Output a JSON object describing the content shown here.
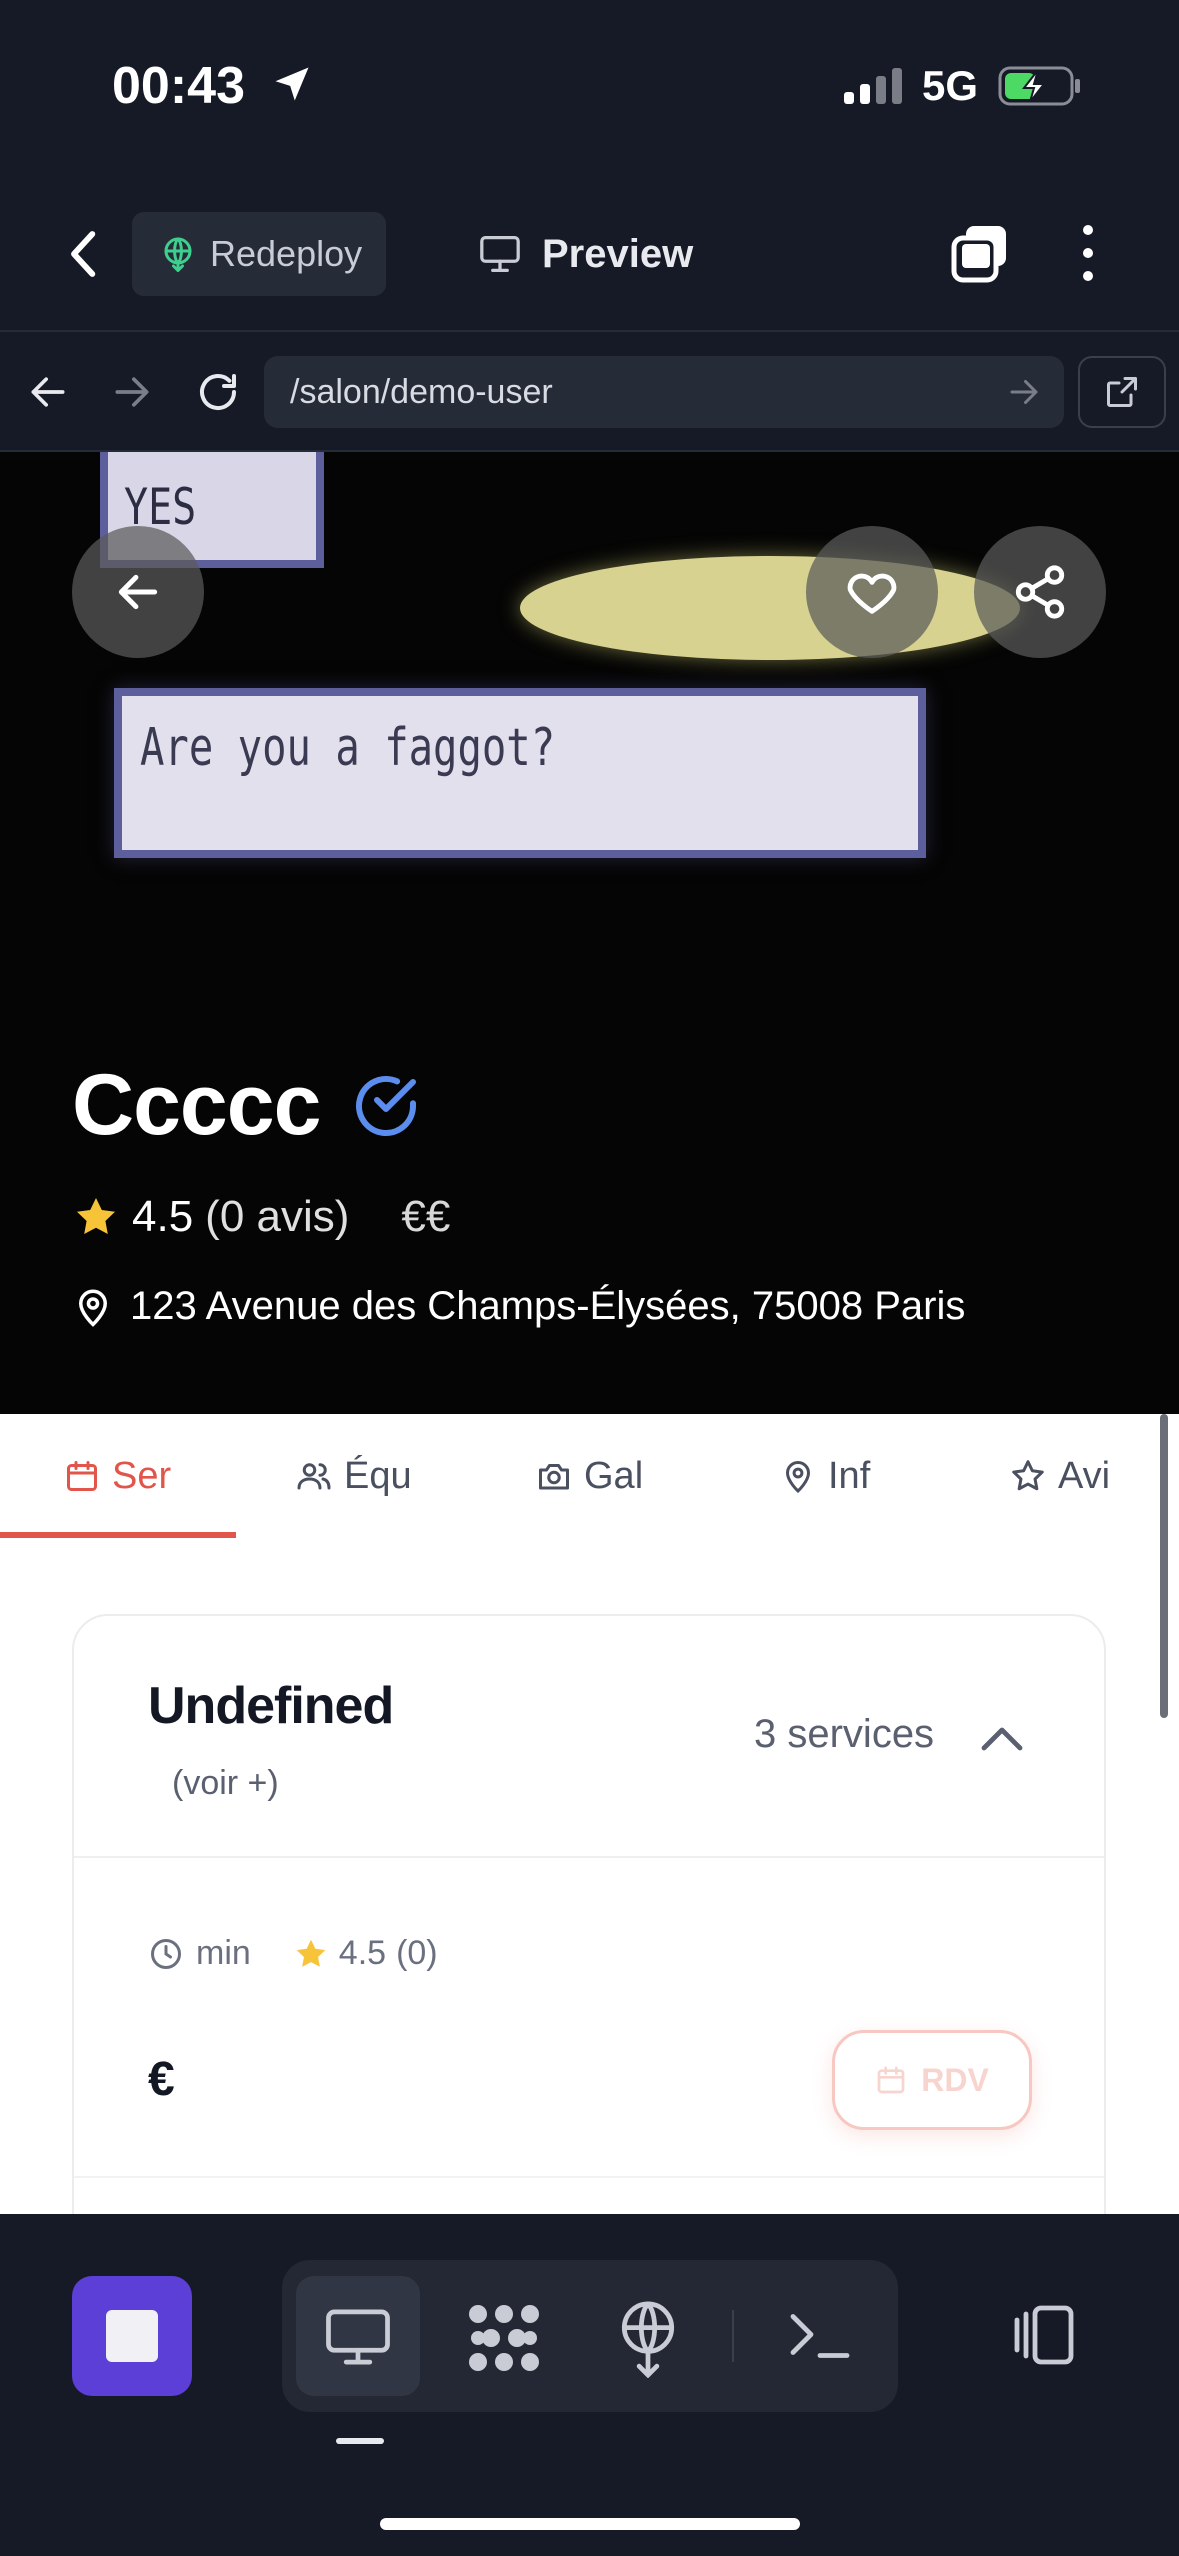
{
  "status_bar": {
    "time": "00:43",
    "network": "5G",
    "battery_state": "charging"
  },
  "toolbar": {
    "redeploy_label": "Redeploy",
    "preview_label": "Preview"
  },
  "url_bar": {
    "url": "/salon/demo-user"
  },
  "hero": {
    "photo_text": "Are you a faggot?",
    "photo_option": "YES",
    "salon_name": "Ccccc",
    "verified": true,
    "rating": "4.5",
    "review_count": "(0 avis)",
    "price_level": "€€",
    "address": "123 Avenue des Champs-Élysées, 75008 Paris"
  },
  "tabs": [
    {
      "label": "Ser",
      "icon": "calendar-icon",
      "active": true
    },
    {
      "label": "Équ",
      "icon": "users-icon",
      "active": false
    },
    {
      "label": "Gal",
      "icon": "camera-icon",
      "active": false
    },
    {
      "label": "Inf",
      "icon": "map-pin-icon",
      "active": false
    },
    {
      "label": "Avi",
      "icon": "star-icon",
      "active": false
    }
  ],
  "category": {
    "title": "Undefined",
    "more": "(voir +)",
    "count": "3 services",
    "service": {
      "duration": "min",
      "rating": "4.5",
      "reviews": "(0)",
      "price": "€",
      "book_label": "RDV"
    }
  },
  "colors": {
    "accent": "#e2554a",
    "stop_button": "#5b3fd6",
    "background_dark": "#161a26"
  }
}
